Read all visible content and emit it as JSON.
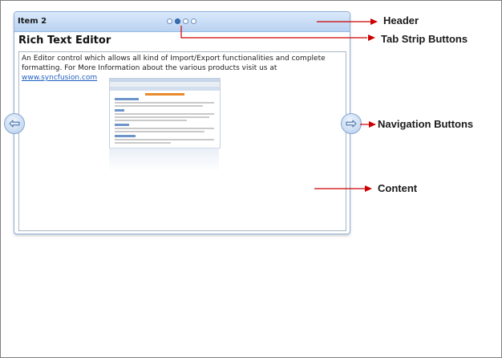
{
  "header": {
    "title": "Item 2",
    "tab_count": 4,
    "active_tab": 2
  },
  "content": {
    "title": "Rich Text Editor",
    "description": "An Editor control which allows all kind of Import/Export functionalities and complete formatting. For More Information about the various products visit us at",
    "link_text": "www.syncfusion.com"
  },
  "navigation": {
    "previous_icon": "arrow-left-icon",
    "next_icon": "arrow-right-icon"
  },
  "callouts": {
    "header": "Header",
    "tab_strip": "Tab Strip Buttons",
    "navigation": "Navigation Buttons",
    "content": "Content"
  },
  "colors": {
    "accent_blue": "#3b6fb4",
    "header_gradient_top": "#dbe9fb",
    "header_gradient_bottom": "#b9d2f1",
    "callout_arrow": "#cc0000",
    "link": "#1f5fbf"
  }
}
